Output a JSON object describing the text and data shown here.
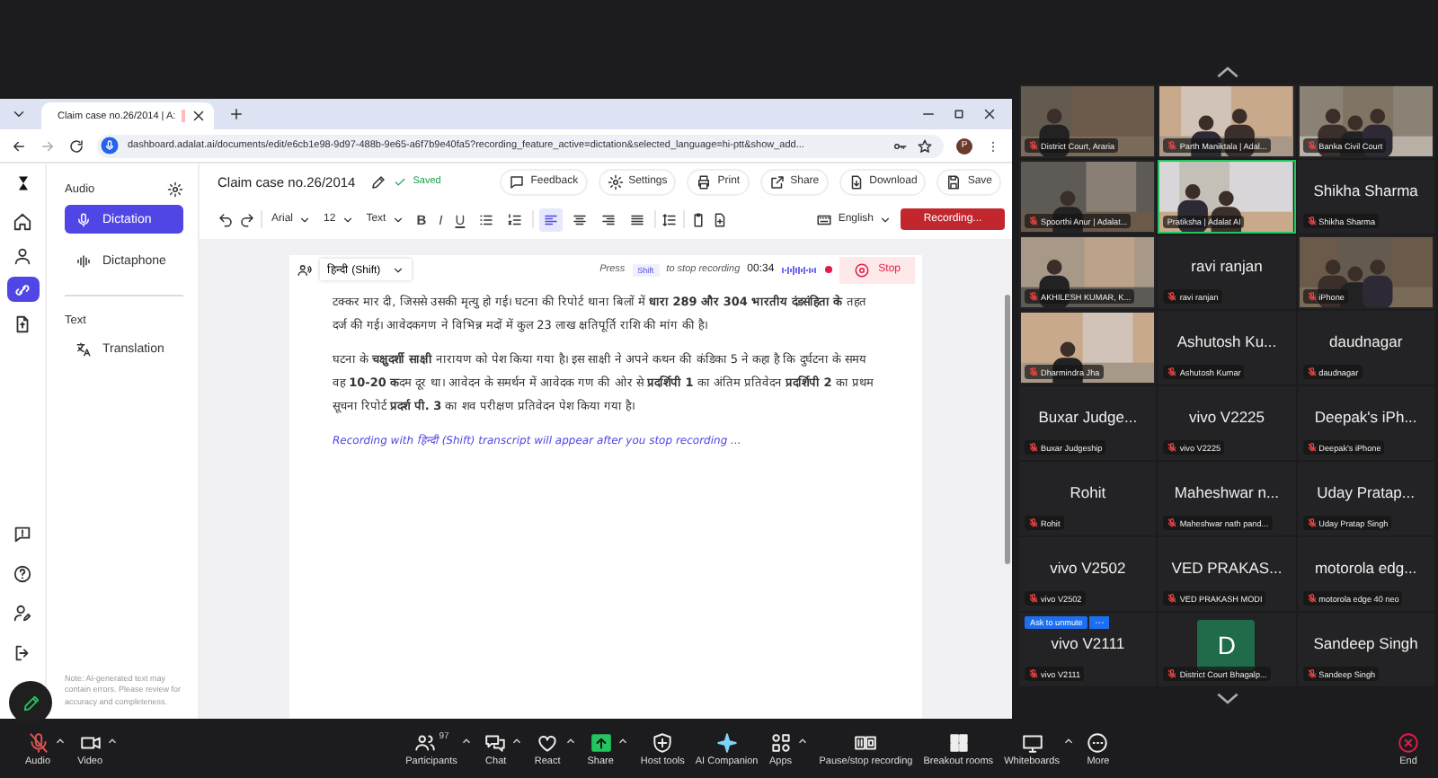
{
  "browser": {
    "tab_title": "Claim case no.26/2014 | A:",
    "url": "dashboard.adalat.ai/documents/edit/e6cb1e98-9d97-488b-9e65-a6f7b9e40fa5?recording_feature_active=dictation&selected_language=hi-ptt&show_add...",
    "profile_initial": "P"
  },
  "document": {
    "title": "Claim case no.26/2014",
    "save_status": "Saved"
  },
  "header_buttons": [
    {
      "kind": "feedback",
      "label": "Feedback"
    },
    {
      "kind": "settings",
      "label": "Settings"
    },
    {
      "kind": "print",
      "label": "Print"
    },
    {
      "kind": "share",
      "label": "Share"
    },
    {
      "kind": "download",
      "label": "Download"
    },
    {
      "kind": "save",
      "label": "Save"
    }
  ],
  "toolbar": {
    "font": "Arial",
    "size": "12",
    "style": "Text",
    "language": "English",
    "record_button": "Recording..."
  },
  "format_buttons": [
    {
      "kind": "bold",
      "label": "B",
      "selected": false
    },
    {
      "kind": "italic",
      "label": "I",
      "selected": false
    },
    {
      "kind": "underline",
      "label": "U",
      "selected": false
    }
  ],
  "list_buttons": [
    {
      "kind": "bullets",
      "selected": false
    },
    {
      "kind": "numbering",
      "selected": false
    }
  ],
  "align_buttons": [
    {
      "kind": "left",
      "selected": true
    },
    {
      "kind": "center",
      "selected": false
    },
    {
      "kind": "right",
      "selected": false
    },
    {
      "kind": "justify",
      "selected": false
    }
  ],
  "nav_rail": [
    {
      "kind": "home",
      "selected": false
    },
    {
      "kind": "user",
      "selected": false
    },
    {
      "kind": "link",
      "selected": true
    },
    {
      "kind": "document",
      "selected": false
    }
  ],
  "nav_rail_bottom": [
    {
      "kind": "message"
    },
    {
      "kind": "help"
    },
    {
      "kind": "user-edit"
    },
    {
      "kind": "logout"
    }
  ],
  "side_panel": {
    "sections": [
      {
        "heading": "Audio",
        "items": [
          {
            "kind": "mic",
            "label": "Dictation",
            "selected": true
          },
          {
            "kind": "wave",
            "label": "Dictaphone",
            "selected": false
          }
        ]
      },
      {
        "heading": "Text",
        "items": [
          {
            "kind": "translate",
            "label": "Translation",
            "selected": false
          }
        ]
      }
    ],
    "note": "Note: AI-generated text may contain errors. Please review for accuracy and completeness."
  },
  "recording_bar": {
    "language": "हिन्दी (Shift)",
    "hint_before": "Press",
    "key": "Shift",
    "hint_after": "to stop recording",
    "timer": "00:34",
    "stop": "Stop"
  },
  "paragraphs": [
    "टक्कर मार दी, जिससे उसकी मृत्यु हो गई। घटना की रिपोर्ट थाना बिलों में **धारा 289 और 304 भारतीय दंडसंहिता के** तहत दर्ज की गई। आवेदकगण ने विभिन्न मदों में कुल 23 लाख क्षतिपूर्ति राशि की मांग की है।",
    "घटना के **चक्षुदर्शी साक्षी** नारायण को पेश किया गया है। इस साक्षी ने अपने कथन की कंडिका 5 ने कहा है कि दुर्घटना के समय वह **10-20 क**दम दूर था। आवेदन के समर्थन में आवेदक गण की ओर से **प्रदर्शिपी 1** का अंतिम प्रतिवेदन **प्रदर्शिपी 2** का प्रथम सूचना रिपोर्ट **प्रदर्श पी. 3** का शव परीक्षण प्रतिवेदन पेश किया गया है।"
  ],
  "transcript_hint": "Recording with हिन्दी (Shift) transcript will appear after you stop recording ...",
  "participants": [
    {
      "kind": "video",
      "caption": "District Court, Araria",
      "muted": true,
      "selected": false
    },
    {
      "kind": "video",
      "caption": "Parth Maniktala | Adal...",
      "muted": true,
      "selected": false
    },
    {
      "kind": "video",
      "caption": "Banka Civil Court",
      "muted": true,
      "selected": false
    },
    {
      "kind": "video",
      "caption": "Spoorthi Anur | Adalat...",
      "muted": true,
      "selected": false
    },
    {
      "kind": "video",
      "caption": "Pratiksha | Adalat AI",
      "muted": false,
      "selected": true
    },
    {
      "kind": "name",
      "display": "Shikha Sharma",
      "caption": "Shikha Sharma",
      "muted": true,
      "selected": false
    },
    {
      "kind": "video",
      "caption": "AKHILESH KUMAR, K...",
      "muted": true,
      "selected": false
    },
    {
      "kind": "name",
      "display": "ravi ranjan",
      "caption": "ravi ranjan",
      "muted": true,
      "selected": false
    },
    {
      "kind": "video",
      "caption": "iPhone",
      "muted": true,
      "selected": false
    },
    {
      "kind": "video",
      "caption": "Dharmindra Jha",
      "muted": true,
      "selected": false
    },
    {
      "kind": "name",
      "display": "Ashutosh Ku...",
      "caption": "Ashutosh Kumar",
      "muted": true,
      "selected": false
    },
    {
      "kind": "name",
      "display": "daudnagar",
      "caption": "daudnagar",
      "muted": true,
      "selected": false
    },
    {
      "kind": "name",
      "display": "Buxar Judge...",
      "caption": "Buxar Judgeship",
      "muted": true,
      "selected": false
    },
    {
      "kind": "name",
      "display": "vivo V2225",
      "caption": "vivo V2225",
      "muted": true,
      "selected": false
    },
    {
      "kind": "name",
      "display": "Deepak's iPh...",
      "caption": "Deepak's iPhone",
      "muted": true,
      "selected": false
    },
    {
      "kind": "name",
      "display": "Rohit",
      "caption": "Rohit",
      "muted": true,
      "selected": false
    },
    {
      "kind": "name",
      "display": "Maheshwar n...",
      "caption": "Maheshwar nath pand...",
      "muted": true,
      "selected": false
    },
    {
      "kind": "name",
      "display": "Uday Pratap...",
      "caption": "Uday Pratap Singh",
      "muted": true,
      "selected": false
    },
    {
      "kind": "name",
      "display": "vivo V2502",
      "caption": "vivo V2502",
      "muted": true,
      "selected": false
    },
    {
      "kind": "name",
      "display": "VED PRAKAS...",
      "caption": "VED PRAKASH MODI",
      "muted": true,
      "selected": false
    },
    {
      "kind": "name",
      "display": "motorola edg...",
      "caption": "motorola edge 40 neo",
      "muted": true,
      "selected": false
    },
    {
      "kind": "name",
      "display": "vivo V2111",
      "caption": "vivo V2111",
      "muted": true,
      "selected": false,
      "action": "Ask to unmute"
    },
    {
      "kind": "avatar",
      "initial": "D",
      "caption": "District Court Bhagalp...",
      "muted": true,
      "selected": false
    },
    {
      "kind": "name",
      "display": "Sandeep Singh",
      "caption": "Sandeep Singh",
      "muted": true,
      "selected": false
    }
  ],
  "meeting_toolbar": {
    "audio_muted": true,
    "items": [
      {
        "kind": "mic",
        "label": "Audio",
        "caret": true
      },
      {
        "kind": "camera",
        "label": "Video",
        "caret": true
      },
      {
        "kind": "people",
        "label": "Participants",
        "badge": "97",
        "caret": true
      },
      {
        "kind": "chat",
        "label": "Chat",
        "caret": true
      },
      {
        "kind": "heart",
        "label": "React",
        "caret": true
      },
      {
        "kind": "share",
        "label": "Share",
        "caret": true
      },
      {
        "kind": "shield",
        "label": "Host tools",
        "caret": false
      },
      {
        "kind": "sparkle",
        "label": "AI Companion",
        "caret": false
      },
      {
        "kind": "apps",
        "label": "Apps",
        "caret": true
      },
      {
        "kind": "pause-stop",
        "label": "Pause/stop recording",
        "caret": false
      },
      {
        "kind": "rooms",
        "label": "Breakout rooms",
        "caret": false
      },
      {
        "kind": "monitor",
        "label": "Whiteboards",
        "caret": true
      },
      {
        "kind": "more",
        "label": "More",
        "caret": false
      },
      {
        "kind": "end",
        "label": "End",
        "caret": false
      }
    ]
  }
}
